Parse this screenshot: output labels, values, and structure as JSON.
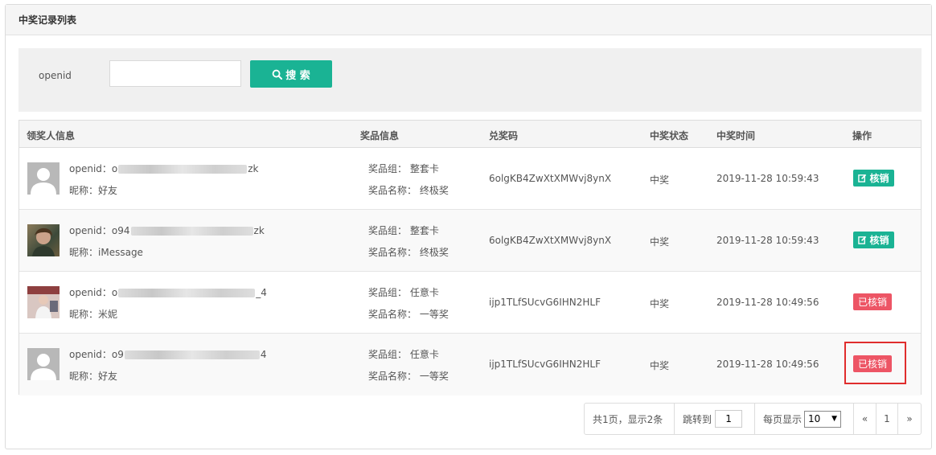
{
  "panel": {
    "title": "中奖记录列表"
  },
  "search": {
    "label": "openid",
    "placeholder": "",
    "value": "",
    "button_label": "搜 索",
    "button_icon": "search-icon"
  },
  "table": {
    "headers": [
      "领奖人信息",
      "奖品信息",
      "兑奖码",
      "中奖状态",
      "中奖时间",
      "操作"
    ],
    "rows": [
      {
        "openid_label": "openid：",
        "openid_prefix": "o",
        "openid_suffix": "zk",
        "nickname_label": "昵称：",
        "nickname": "好友",
        "avatar": "default-avatar",
        "group_label": "奖品组：",
        "group": "整套卡",
        "prize_label": "奖品名称：",
        "prize": "终极奖",
        "code": "6olgKB4ZwXtXMWvj8ynX",
        "status": "中奖",
        "time": "2019-11-28 10:59:43",
        "action": "核销",
        "action_state": "pending"
      },
      {
        "openid_label": "openid：",
        "openid_prefix": "o94",
        "openid_suffix": "zk",
        "nickname_label": "昵称：",
        "nickname": "iMessage",
        "avatar": "photo-avatar",
        "group_label": "奖品组：",
        "group": "整套卡",
        "prize_label": "奖品名称：",
        "prize": "终极奖",
        "code": "6olgKB4ZwXtXMWvj8ynX",
        "status": "中奖",
        "time": "2019-11-28 10:59:43",
        "action": "核销",
        "action_state": "pending"
      },
      {
        "openid_label": "openid：",
        "openid_prefix": "o",
        "openid_suffix": "_4",
        "nickname_label": "昵称：",
        "nickname": "米妮",
        "avatar": "photo-avatar",
        "group_label": "奖品组：",
        "group": "任意卡",
        "prize_label": "奖品名称：",
        "prize": "一等奖",
        "code": "ijp1TLfSUcvG6IHN2HLF",
        "status": "中奖",
        "time": "2019-11-28 10:49:56",
        "action": "已核销",
        "action_state": "done"
      },
      {
        "openid_label": "openid：",
        "openid_prefix": "o9",
        "openid_suffix": "4",
        "nickname_label": "昵称：",
        "nickname": "好友",
        "avatar": "default-avatar",
        "group_label": "奖品组：",
        "group": "任意卡",
        "prize_label": "奖品名称：",
        "prize": "一等奖",
        "code": "ijp1TLfSUcvG6IHN2HLF",
        "status": "中奖",
        "time": "2019-11-28 10:49:56",
        "action": "已核销",
        "action_state": "done"
      }
    ]
  },
  "pager": {
    "summary": "共1页，显示2条",
    "jump_label": "跳转到",
    "jump_value": "1",
    "per_page_label": "每页显示",
    "per_page_value": "10",
    "prev": "«",
    "current_page": "1",
    "next": "»"
  },
  "colors": {
    "primary": "#1ab394",
    "danger": "#ed5565",
    "highlight": "#e02d2d"
  }
}
